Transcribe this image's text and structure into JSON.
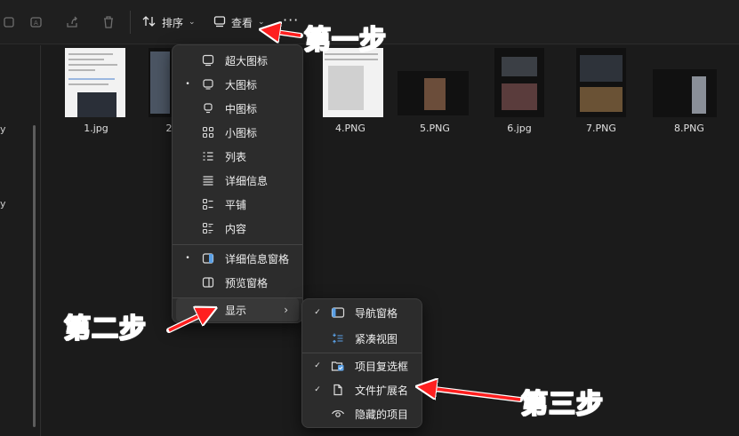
{
  "toolbar": {
    "sort_label": "排序",
    "view_label": "查看",
    "more_label": "···",
    "icons": [
      "rename-icon",
      "share-icon",
      "delete-icon",
      "sort-icon",
      "view-icon"
    ]
  },
  "sidebar": {
    "fragments": [
      "y",
      "y"
    ]
  },
  "files": [
    {
      "name": "1.jpg"
    },
    {
      "name": "2"
    },
    {
      "name": "4.PNG"
    },
    {
      "name": "5.PNG"
    },
    {
      "name": "6.jpg"
    },
    {
      "name": "7.PNG"
    },
    {
      "name": "8.PNG"
    }
  ],
  "view_menu": {
    "items": [
      {
        "label": "超大图标",
        "checked": false,
        "icon": "extra-large-icons-icon"
      },
      {
        "label": "大图标",
        "checked": true,
        "icon": "large-icons-icon"
      },
      {
        "label": "中图标",
        "checked": false,
        "icon": "medium-icons-icon"
      },
      {
        "label": "小图标",
        "checked": false,
        "icon": "small-icons-icon"
      },
      {
        "label": "列表",
        "checked": false,
        "icon": "list-icon"
      },
      {
        "label": "详细信息",
        "checked": false,
        "icon": "details-icon"
      },
      {
        "label": "平铺",
        "checked": false,
        "icon": "tiles-icon"
      },
      {
        "label": "内容",
        "checked": false,
        "icon": "content-icon"
      },
      {
        "label": "详细信息窗格",
        "checked": true,
        "icon": "details-pane-icon"
      },
      {
        "label": "预览窗格",
        "checked": false,
        "icon": "preview-pane-icon"
      },
      {
        "label": "显示",
        "checked": false,
        "icon": "",
        "submenu": true
      }
    ],
    "check_mark": "•",
    "submenu_arrow": "›"
  },
  "show_menu": {
    "items": [
      {
        "label": "导航窗格",
        "checked": true,
        "icon": "navigation-pane-icon"
      },
      {
        "label": "紧凑视图",
        "checked": false,
        "icon": "compact-view-icon"
      },
      {
        "label": "项目复选框",
        "checked": true,
        "icon": "item-checkbox-icon"
      },
      {
        "label": "文件扩展名",
        "checked": true,
        "icon": "file-extension-icon"
      },
      {
        "label": "隐藏的项目",
        "checked": false,
        "icon": "hidden-items-icon"
      }
    ],
    "check_mark": "✓"
  },
  "annotations": {
    "step1": "第一步",
    "step2": "第二步",
    "step3": "第三步",
    "color": "#ff1f1f"
  }
}
